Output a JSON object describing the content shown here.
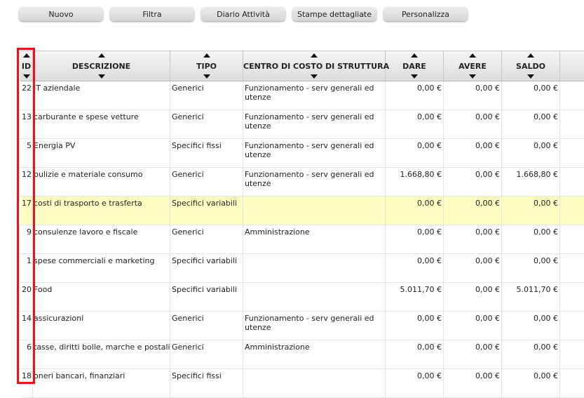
{
  "toolbar": {
    "buttons": [
      "Nuovo",
      "Filtra",
      "Diario Attività",
      "Stampe dettagliate",
      "Personalizza"
    ]
  },
  "table": {
    "columns": [
      "ID",
      "DESCRIZIONE",
      "TIPO",
      "CENTRO DI COSTO DI STRUTTURA",
      "DARE",
      "AVERE",
      "SALDO"
    ],
    "rows": [
      {
        "id": "22",
        "desc": "IT aziendale",
        "tipo": "Generici",
        "cc": "Funzionamento - serv generali ed utenze",
        "dare": "0,00 €",
        "avere": "0,00 €",
        "saldo": "0,00 €"
      },
      {
        "id": "13",
        "desc": "carburante e spese vetture",
        "tipo": "Generici",
        "cc": "Funzionamento - serv generali ed utenze",
        "dare": "0,00 €",
        "avere": "0,00 €",
        "saldo": "0,00 €"
      },
      {
        "id": "5",
        "desc": "Energia PV",
        "tipo": "Specifici fissi",
        "cc": "Funzionamento - serv generali ed utenze",
        "dare": "0,00 €",
        "avere": "0,00 €",
        "saldo": "0,00 €"
      },
      {
        "id": "12",
        "desc": "pulizie e materiale consumo",
        "tipo": "Generici",
        "cc": "Funzionamento - serv generali ed utenze",
        "dare": "1.668,80 €",
        "avere": "0,00 €",
        "saldo": "1.668,80 €"
      },
      {
        "id": "17",
        "desc": "costi di trasporto e trasferta",
        "tipo": "Specifici variabili",
        "cc": "",
        "dare": "0,00 €",
        "avere": "0,00 €",
        "saldo": "0,00 €",
        "highlight": true
      },
      {
        "id": "9",
        "desc": "consulenze lavoro e fiscale",
        "tipo": "Generici",
        "cc": "Amministrazione",
        "dare": "0,00 €",
        "avere": "0,00 €",
        "saldo": "0,00 €"
      },
      {
        "id": "1",
        "desc": "spese commerciali e marketing",
        "tipo": "Specifici variabili",
        "cc": "",
        "dare": "0,00 €",
        "avere": "0,00 €",
        "saldo": "0,00 €"
      },
      {
        "id": "20",
        "desc": "Food",
        "tipo": "Specifici variabili",
        "cc": "",
        "dare": "5.011,70 €",
        "avere": "0,00 €",
        "saldo": "5.011,70 €"
      },
      {
        "id": "14",
        "desc": "assicurazioni",
        "tipo": "Generici",
        "cc": "Funzionamento - serv generali ed utenze",
        "dare": "0,00 €",
        "avere": "0,00 €",
        "saldo": "0,00 €"
      },
      {
        "id": "6",
        "desc": "tasse, diritti bolle, marche e postali",
        "tipo": "Generici",
        "cc": "Amministrazione",
        "dare": "0,00 €",
        "avere": "0,00 €",
        "saldo": "0,00 €"
      },
      {
        "id": "18",
        "desc": "oneri bancari, finanziari",
        "tipo": "Specifici fissi",
        "cc": "",
        "dare": "0,00 €",
        "avere": "0,00 €",
        "saldo": "0,00 €"
      }
    ]
  },
  "colors": {
    "highlight_row": "#ffffc4",
    "selection_border": "#e8141c"
  }
}
